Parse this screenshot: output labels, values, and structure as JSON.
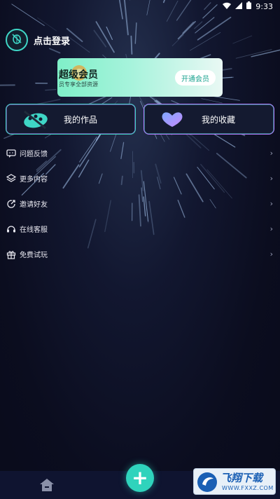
{
  "status_bar": {
    "time": "9:33"
  },
  "header": {
    "login_label": "点击登录"
  },
  "vip_banner": {
    "title": "超级会员",
    "subtitle": "员专享全部资源",
    "button_label": "开通会员"
  },
  "cards": {
    "works_label": "我的作品",
    "favorites_label": "我的收藏"
  },
  "menu": {
    "items": [
      {
        "label": "问题反馈",
        "icon": "chat-icon"
      },
      {
        "label": "更多内容",
        "icon": "layers-icon"
      },
      {
        "label": "邀请好友",
        "icon": "share-icon"
      },
      {
        "label": "在线客服",
        "icon": "headset-icon"
      },
      {
        "label": "免费试玩",
        "icon": "gift-icon"
      }
    ],
    "chevron": "›"
  },
  "bottom_nav": {
    "fab_label": "+"
  },
  "watermark": {
    "title": "飞翔下载",
    "url": "WWW.FXXZ.COM"
  },
  "colors": {
    "background": "#0a0c1c",
    "accent_teal": "#3fd6c6",
    "accent_purple": "#b57bff",
    "fab": "#2fd3bc"
  }
}
